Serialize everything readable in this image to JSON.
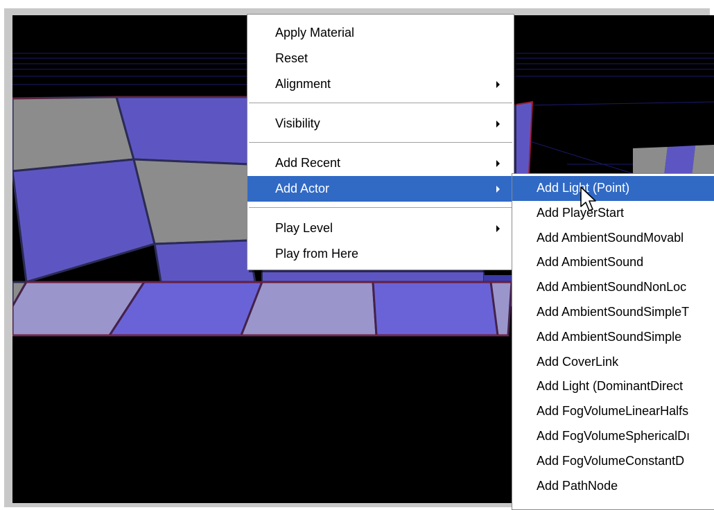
{
  "main_menu": {
    "groups": [
      [
        {
          "label": "Apply Material",
          "submenu": false
        },
        {
          "label": "Reset",
          "submenu": false
        },
        {
          "label": "Alignment",
          "submenu": true
        }
      ],
      [
        {
          "label": "Visibility",
          "submenu": true
        }
      ],
      [
        {
          "label": "Add Recent",
          "submenu": true
        },
        {
          "label": "Add Actor",
          "submenu": true,
          "selected": true
        }
      ],
      [
        {
          "label": "Play Level",
          "submenu": true
        },
        {
          "label": "Play from Here",
          "submenu": false
        }
      ]
    ]
  },
  "add_actor_submenu": {
    "items": [
      {
        "label": "Add Light (Point)",
        "selected": true
      },
      {
        "label": "Add PlayerStart"
      },
      {
        "label": "Add AmbientSoundMovabl"
      },
      {
        "label": "Add AmbientSound"
      },
      {
        "label": "Add AmbientSoundNonLoc"
      },
      {
        "label": "Add AmbientSoundSimpleT"
      },
      {
        "label": "Add AmbientSoundSimple"
      },
      {
        "label": "Add CoverLink"
      },
      {
        "label": "Add Light (DominantDirect"
      },
      {
        "label": "Add FogVolumeLinearHalfs"
      },
      {
        "label": "Add FogVolumeSphericalDı"
      },
      {
        "label": "Add FogVolumeConstantD"
      },
      {
        "label": "Add PathNode"
      }
    ]
  },
  "colors": {
    "viewport_bg": "#000000",
    "tile_blue": "#5d56c2",
    "tile_gray": "#8c8c8c",
    "menu_highlight": "#316ac5",
    "brush_outline": "#9b1b30"
  }
}
